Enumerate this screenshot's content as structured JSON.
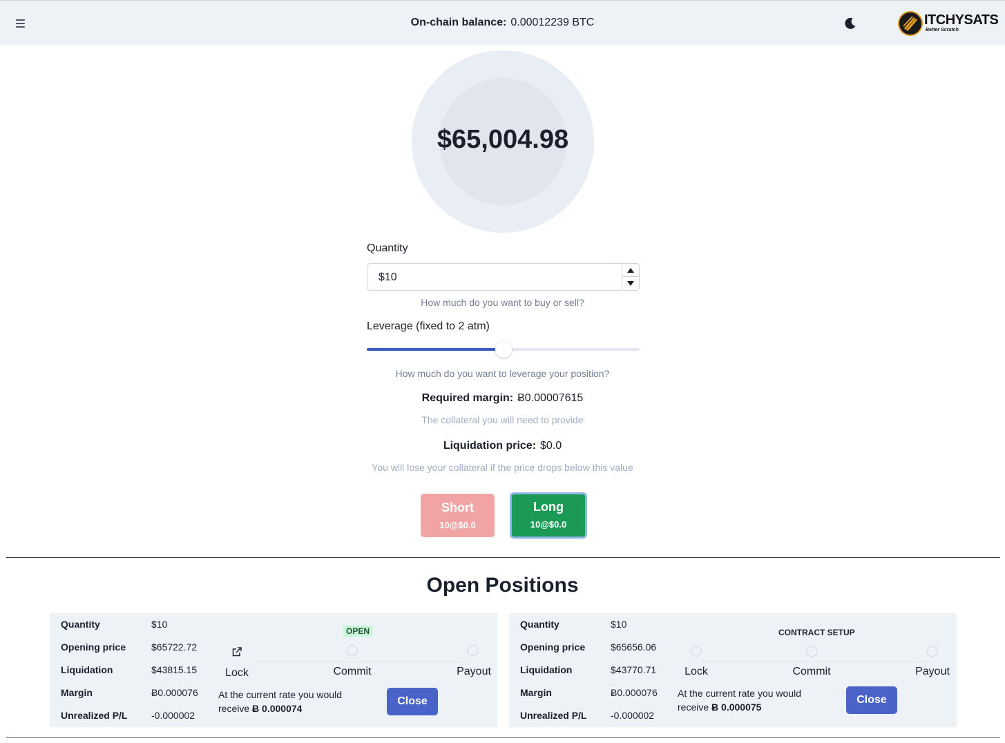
{
  "header": {
    "balance_label": "On-chain balance:",
    "balance_value": "0.00012239 BTC",
    "logo_text": "ITCHYSATS",
    "logo_tagline": "Better Scratch",
    "menu_icon": "hamburger-icon",
    "theme_icon": "moon-icon"
  },
  "ticker": {
    "price": "$65,004.98"
  },
  "form": {
    "quantity_label": "Quantity",
    "quantity_value": "$10",
    "quantity_helper": "How much do you want to buy or sell?",
    "leverage_label": "Leverage (fixed to 2 atm)",
    "leverage_fraction": 0.5,
    "leverage_helper": "How much do you want to leverage your position?",
    "margin_label": "Required margin:",
    "margin_value": "Ƀ0.00007615",
    "margin_helper": "The collateral you will need to provide",
    "liquidation_label": "Liquidation price:",
    "liquidation_value": "$0.0",
    "liquidation_helper": "You will lose your collateral if the price drops below this value",
    "short_label": "Short",
    "short_sub": "10@$0.0",
    "long_label": "Long",
    "long_sub": "10@$0.0"
  },
  "colors": {
    "short": "#f2a3a3",
    "long": "#1a9a55",
    "accent": "#4a63c9",
    "open_badge": "#c6f6d5"
  },
  "positions": {
    "title": "Open Positions",
    "labels": {
      "quantity": "Quantity",
      "opening_price": "Opening price",
      "liquidation": "Liquidation",
      "margin": "Margin",
      "pnl": "Unrealized P/L",
      "lock": "Lock",
      "commit": "Commit",
      "payout": "Payout",
      "receive_text": "At the current rate you would receive",
      "close": "Close"
    },
    "items": [
      {
        "status": "OPEN",
        "quantity": "$10",
        "opening_price": "$65722.72",
        "liquidation": "$43815.15",
        "margin": "Ƀ0.000076",
        "pnl": "-0.000002",
        "receive_amount": "Ƀ 0.000074"
      },
      {
        "status": "CONTRACT SETUP",
        "quantity": "$10",
        "opening_price": "$65656.06",
        "liquidation": "$43770.71",
        "margin": "Ƀ0.000076",
        "pnl": "-0.000002",
        "receive_amount": "Ƀ 0.000075"
      }
    ]
  }
}
